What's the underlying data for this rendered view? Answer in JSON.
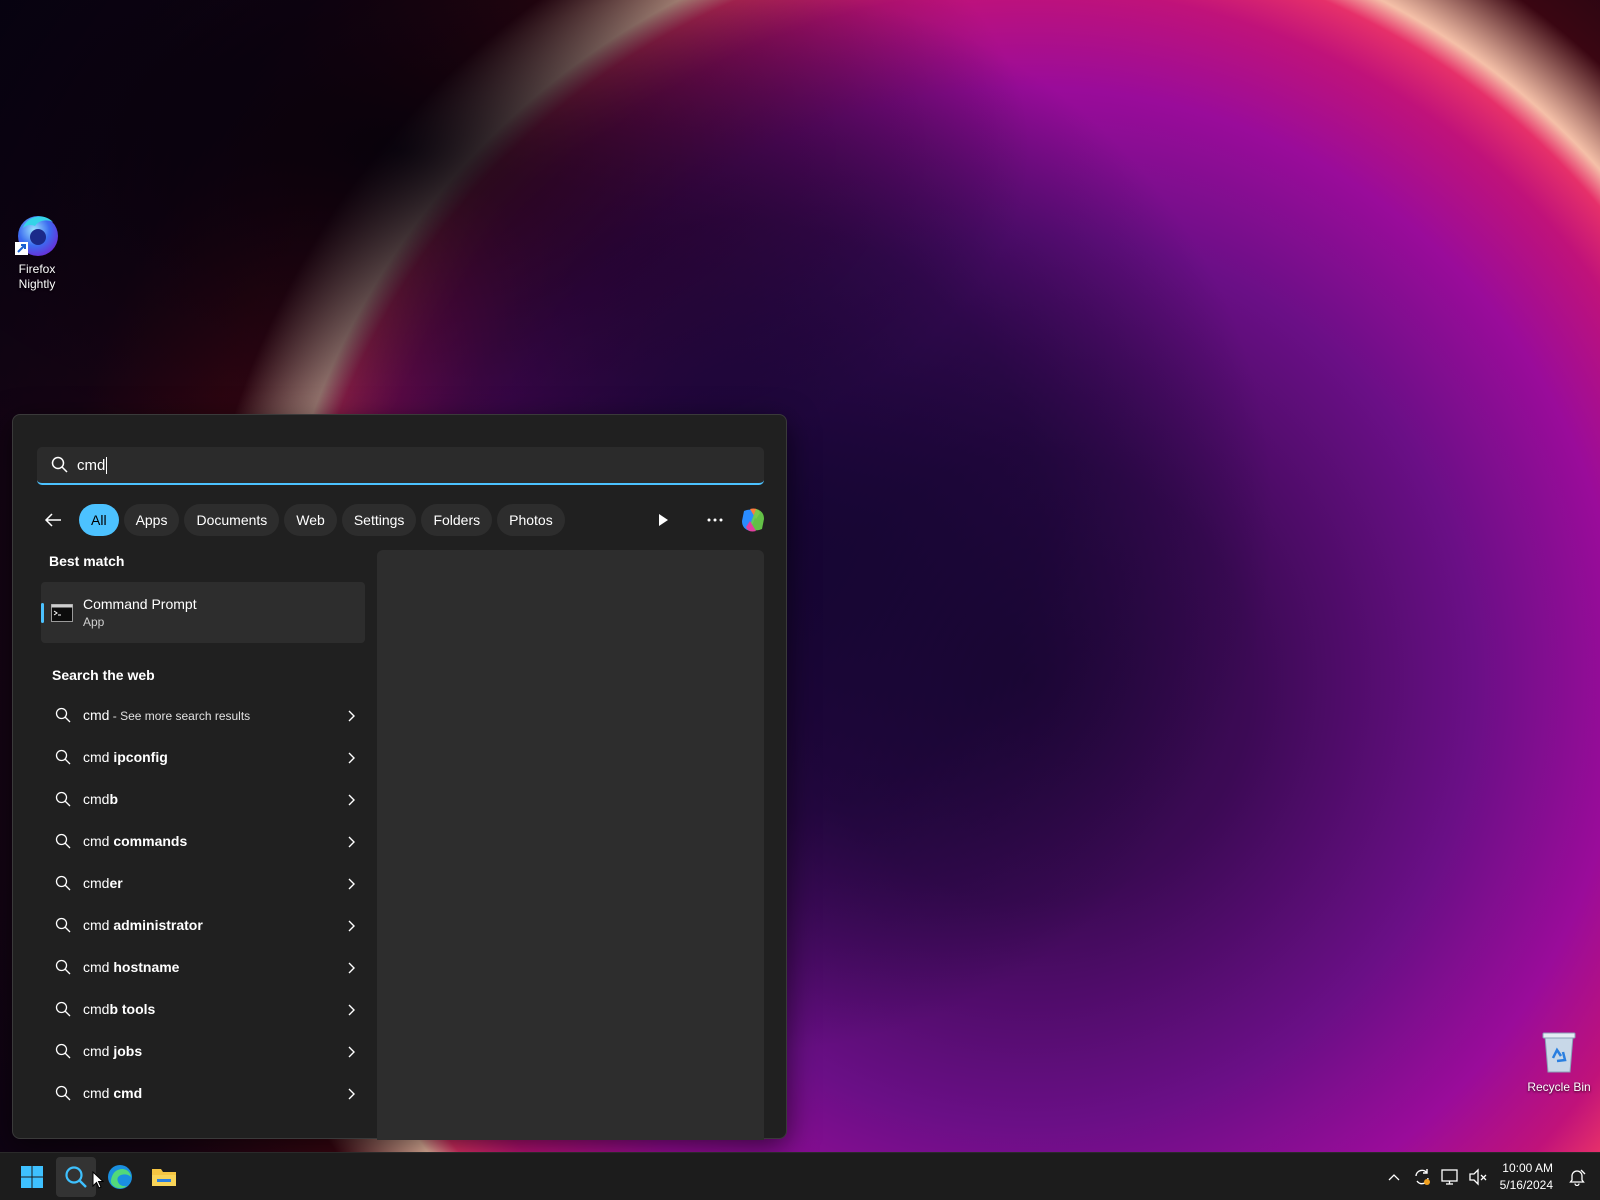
{
  "desktop": {
    "icons": [
      {
        "label": "Firefox Nightly",
        "icon": "firefox-nightly-icon"
      },
      {
        "label": "Recycle Bin",
        "icon": "recycle-bin-icon"
      }
    ]
  },
  "search": {
    "query": "cmd",
    "filters": [
      "All",
      "Apps",
      "Documents",
      "Web",
      "Settings",
      "Folders",
      "Photos"
    ],
    "active_filter": "All"
  },
  "best_match": {
    "section_title": "Best match",
    "title": "Command Prompt",
    "subtitle": "App"
  },
  "web": {
    "section_title": "Search the web",
    "items": [
      {
        "prefix": "cmd",
        "bold": "",
        "suffix": " - See more search results"
      },
      {
        "prefix": "cmd ",
        "bold": "ipconfig",
        "suffix": ""
      },
      {
        "prefix": "cmd",
        "bold": "b",
        "suffix": ""
      },
      {
        "prefix": "cmd ",
        "bold": "commands",
        "suffix": ""
      },
      {
        "prefix": "cmd",
        "bold": "er",
        "suffix": ""
      },
      {
        "prefix": "cmd ",
        "bold": "administrator",
        "suffix": ""
      },
      {
        "prefix": "cmd ",
        "bold": "hostname",
        "suffix": ""
      },
      {
        "prefix": "cmd",
        "bold": "b tools",
        "suffix": ""
      },
      {
        "prefix": "cmd ",
        "bold": "jobs",
        "suffix": ""
      },
      {
        "prefix": "cmd ",
        "bold": "cmd",
        "suffix": ""
      }
    ]
  },
  "taskbar": {
    "time": "10:00 AM",
    "date": "5/16/2024"
  },
  "colors": {
    "accent": "#4cc2ff",
    "panel_bg": "#202020",
    "taskbar_bg": "#1c1c1c"
  }
}
